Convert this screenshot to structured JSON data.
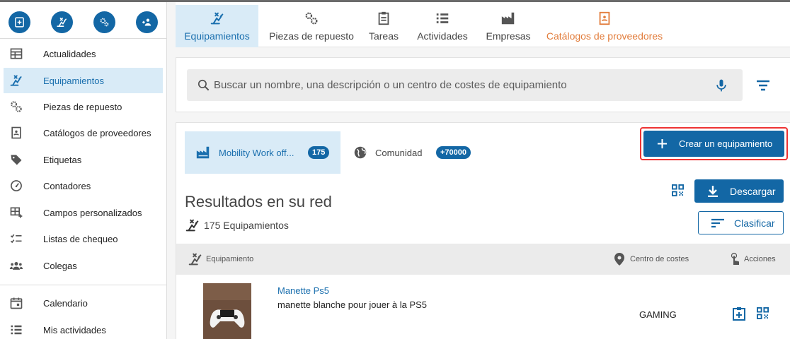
{
  "sidebar": {
    "quick_actions": [
      {
        "name": "new-request-icon"
      },
      {
        "name": "equipment-icon"
      },
      {
        "name": "parts-icon"
      },
      {
        "name": "add-colleague-icon"
      }
    ],
    "items": [
      {
        "label": "Actualidades",
        "icon": "news-icon"
      },
      {
        "label": "Equipamientos",
        "icon": "equipment-icon"
      },
      {
        "label": "Piezas de repuesto",
        "icon": "gears-icon"
      },
      {
        "label": "Catálogos de proveedores",
        "icon": "catalog-icon"
      },
      {
        "label": "Etiquetas",
        "icon": "tag-icon"
      },
      {
        "label": "Contadores",
        "icon": "gauge-icon"
      },
      {
        "label": "Campos personalizados",
        "icon": "custom-fields-icon"
      },
      {
        "label": "Listas de chequeo",
        "icon": "checklist-icon"
      },
      {
        "label": "Colegas",
        "icon": "people-icon"
      },
      {
        "label": "Calendario",
        "icon": "calendar-icon"
      },
      {
        "label": "Mis actividades",
        "icon": "list-icon"
      }
    ]
  },
  "tabs": [
    {
      "label": "Equipamientos",
      "icon": "equipment-icon"
    },
    {
      "label": "Piezas de repuesto",
      "icon": "gears-icon"
    },
    {
      "label": "Tareas",
      "icon": "clipboard-icon"
    },
    {
      "label": "Actividades",
      "icon": "list-icon"
    },
    {
      "label": "Empresas",
      "icon": "factory-icon"
    },
    {
      "label": "Catálogos de proveedores",
      "icon": "catalog-icon"
    }
  ],
  "search": {
    "placeholder": "Buscar un nombre, una descripción o un centro de costes de equipamiento"
  },
  "sources": [
    {
      "label": "Mobility Work off...",
      "count": "175",
      "icon": "factory-icon"
    },
    {
      "label": "Comunidad",
      "count": "+70000",
      "icon": "globe-icon"
    }
  ],
  "actions": {
    "create": "Crear un equipamiento",
    "download": "Descargar",
    "sort": "Clasificar"
  },
  "results": {
    "title": "Resultados en su red",
    "count": "175 Equipamientos"
  },
  "table": {
    "headers": {
      "equipment": "Equipamiento",
      "cost_center": "Centro de costes",
      "actions": "Acciones"
    },
    "rows": [
      {
        "name": "Manette Ps5",
        "description": "manette blanche pour jouer à la PS5",
        "cost_center": "GAMING"
      }
    ]
  },
  "colors": {
    "primary": "#1367a5",
    "active_bg": "#d9ebf7",
    "orange": "#e27d3c",
    "highlight": "#e33333"
  }
}
